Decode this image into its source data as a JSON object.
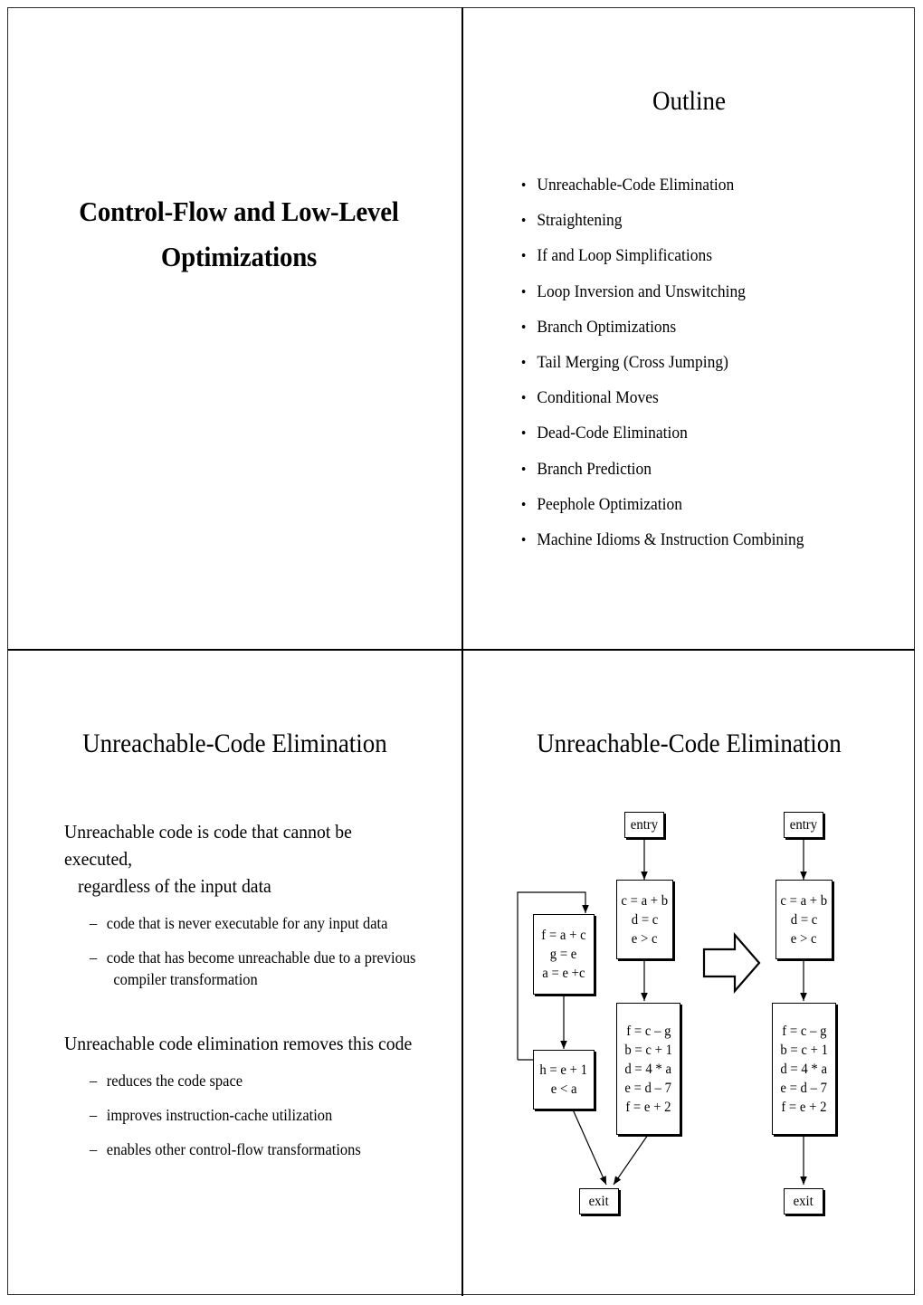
{
  "slides": {
    "title": {
      "lines": [
        "Control-Flow and Low-Level",
        "Optimizations"
      ]
    },
    "outline": {
      "heading": "Outline",
      "bullet_glyph": "•",
      "items": [
        "Unreachable-Code Elimination",
        "Straightening",
        "If and Loop Simplifications",
        "Loop Inversion and Unswitching",
        "Branch Optimizations",
        "Tail Merging (Cross Jumping)",
        "Conditional Moves",
        "Dead-Code Elimination",
        "Branch Prediction",
        "Peephole Optimization",
        "Machine Idioms & Instruction Combining"
      ]
    },
    "uce_text": {
      "heading": "Unreachable-Code Elimination",
      "dash_glyph": "–",
      "block1": {
        "line1": "Unreachable code is code that cannot be executed,",
        "line2": "regardless of the input data",
        "subitems": [
          {
            "line1": "code that is never executable for any input data",
            "line2": ""
          },
          {
            "line1": "code that has become unreachable due to a previous",
            "line2": "compiler transformation"
          }
        ]
      },
      "block2": {
        "line1": "Unreachable code elimination removes this code",
        "line2": "",
        "subitems": [
          {
            "line1": "reduces the code space",
            "line2": ""
          },
          {
            "line1": "improves instruction-cache utilization",
            "line2": ""
          },
          {
            "line1": "enables other control-flow transformations",
            "line2": ""
          }
        ]
      }
    },
    "uce_diagram": {
      "heading": "Unreachable-Code Elimination",
      "transform_arrow": "block-arrow-right",
      "before": {
        "entry": "entry",
        "exit": "exit",
        "blocks": {
          "b1": [
            "c = a + b",
            "d = c",
            "e > c"
          ],
          "b2": [
            "f = a + c",
            "g = e",
            "a = e +c"
          ],
          "b3": [
            "h = e + 1",
            "e < a"
          ],
          "b4": [
            "f = c – g",
            "b = c + 1",
            "d = 4 * a",
            "e = d – 7",
            "f = e + 2"
          ]
        }
      },
      "after": {
        "entry": "entry",
        "exit": "exit",
        "blocks": {
          "b1": [
            "c = a + b",
            "d = c",
            "e > c"
          ],
          "b4": [
            "f = c – g",
            "b = c + 1",
            "d = 4 * a",
            "e = d – 7",
            "f = e + 2"
          ]
        }
      }
    }
  },
  "colors": {
    "ink": "#000000",
    "paper": "#ffffff",
    "frame": "#2a2a2a"
  }
}
